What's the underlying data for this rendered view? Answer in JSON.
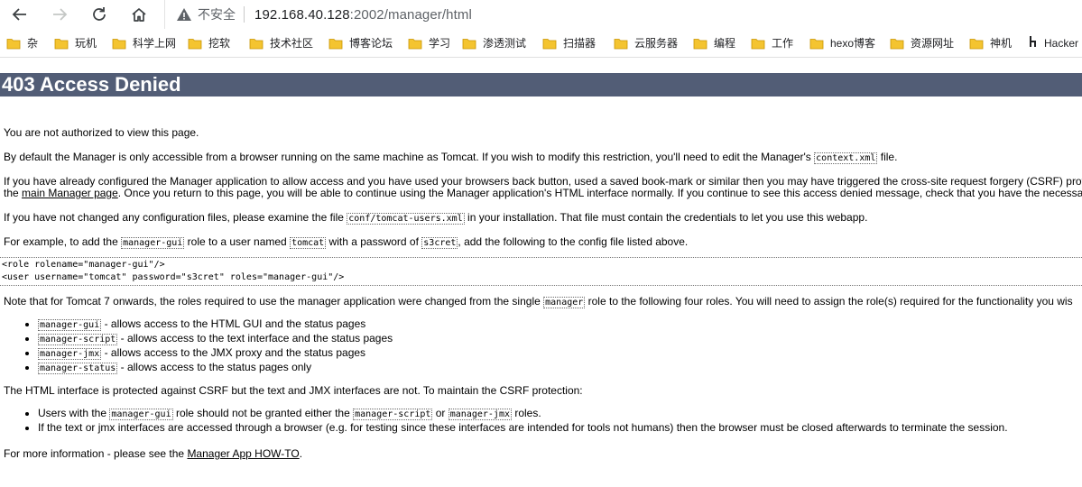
{
  "browser": {
    "insecure_label": "不安全",
    "url_host": "192.168.40.128",
    "url_path": ":2002/manager/html",
    "bookmarks": [
      "杂",
      "玩机",
      "科学上网",
      "挖软",
      "技术社区",
      "博客论坛",
      "学习",
      "渗透测试",
      "扫描器",
      "云服务器",
      "编程",
      "工作",
      "hexo博客",
      "资源网址",
      "神机",
      "Hacker"
    ],
    "accent_folder_color": "#f4c430"
  },
  "page": {
    "title": "403 Access Denied",
    "p1": "You are not authorized to view this page.",
    "p2_a": "By default the Manager is only accessible from a browser running on the same machine as Tomcat. If you wish to modify this restriction, you'll need to edit the Manager's",
    "p2_code": "context.xml",
    "p2_b": "file.",
    "p3_a": "If you have already configured the Manager application to allow access and you have used your browsers back button, used a saved book-mark or similar then you may have triggered the cross-site request forgery (CSRF) prot",
    "p3_b": "the",
    "p3_link": "main Manager page",
    "p3_c": ". Once you return to this page, you will be able to continue using the Manager application's HTML interface normally. If you continue to see this access denied message, check that you have the necessar",
    "p4_a": "If you have not changed any configuration files, please examine the file",
    "p4_code": "conf/tomcat-users.xml",
    "p4_b": "in your installation. That file must contain the credentials to let you use this webapp.",
    "p5_a": "For example, to add the",
    "p5_code1": "manager-gui",
    "p5_b": "role to a user named",
    "p5_code2": "tomcat",
    "p5_c": "with a password of",
    "p5_code3": "s3cret",
    "p5_d": ", add the following to the config file listed above.",
    "pre_line1": "<role rolename=\"manager-gui\"/>",
    "pre_line2": "<user username=\"tomcat\" password=\"s3cret\" roles=\"manager-gui\"/>",
    "p6_a": "Note that for Tomcat 7 onwards, the roles required to use the manager application were changed from the single",
    "p6_code": "manager",
    "p6_b": "role to the following four roles. You will need to assign the role(s) required for the functionality you wis",
    "roles": [
      {
        "code": "manager-gui",
        "desc": "- allows access to the HTML GUI and the status pages"
      },
      {
        "code": "manager-script",
        "desc": "- allows access to the text interface and the status pages"
      },
      {
        "code": "manager-jmx",
        "desc": "- allows access to the JMX proxy and the status pages"
      },
      {
        "code": "manager-status",
        "desc": "- allows access to the status pages only"
      }
    ],
    "p7": "The HTML interface is protected against CSRF but the text and JMX interfaces are not. To maintain the CSRF protection:",
    "csrf_1_a": "Users with the",
    "csrf_1_code1": "manager-gui",
    "csrf_1_b": "role should not be granted either the",
    "csrf_1_code2": "manager-script",
    "csrf_1_c": "or",
    "csrf_1_code3": "manager-jmx",
    "csrf_1_d": "roles.",
    "csrf_2": "If the text or jmx interfaces are accessed through a browser (e.g. for testing since these interfaces are intended for tools not humans) then the browser must be closed afterwards to terminate the session.",
    "p8_a": "For more information - please see the",
    "p8_link": "Manager App HOW-TO",
    "p8_b": "."
  }
}
